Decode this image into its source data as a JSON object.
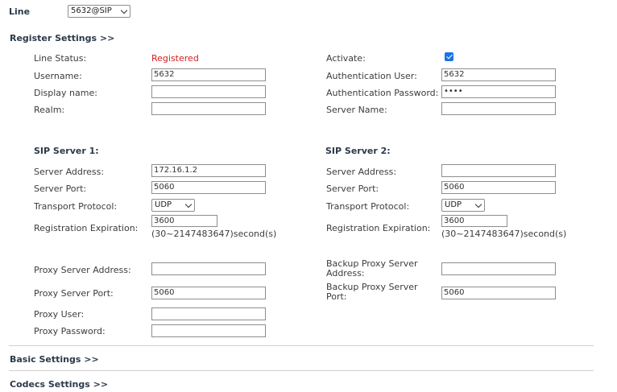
{
  "line": {
    "label": "Line",
    "selected": "5632@SIP"
  },
  "register_settings": {
    "header": "Register Settings >>",
    "left": {
      "line_status_label": "Line Status:",
      "line_status_value": "Registered",
      "username_label": "Username:",
      "username_value": "5632",
      "display_name_label": "Display name:",
      "display_name_value": "",
      "realm_label": "Realm:",
      "realm_value": ""
    },
    "right": {
      "activate_label": "Activate:",
      "activate_checked": true,
      "auth_user_label": "Authentication User:",
      "auth_user_value": "5632",
      "auth_password_label": "Authentication Password:",
      "auth_password_value": "••••",
      "server_name_label": "Server Name:",
      "server_name_value": ""
    }
  },
  "sip_server_1": {
    "title": "SIP Server 1:",
    "server_address_label": "Server Address:",
    "server_address_value": "172.16.1.2",
    "server_port_label": "Server Port:",
    "server_port_value": "5060",
    "transport_label": "Transport Protocol:",
    "transport_value": "UDP",
    "expiration_label": "Registration Expiration:",
    "expiration_value": "3600",
    "expiration_hint": "(30~2147483647)second(s)"
  },
  "sip_server_2": {
    "title": "SIP Server 2:",
    "server_address_label": "Server Address:",
    "server_address_value": "",
    "server_port_label": "Server Port:",
    "server_port_value": "5060",
    "transport_label": "Transport Protocol:",
    "transport_value": "UDP",
    "expiration_label": "Registration Expiration:",
    "expiration_value": "3600",
    "expiration_hint": "(30~2147483647)second(s)"
  },
  "proxy": {
    "proxy_address_label": "Proxy Server Address:",
    "proxy_address_value": "",
    "proxy_port_label": "Proxy Server Port:",
    "proxy_port_value": "5060",
    "proxy_user_label": "Proxy User:",
    "proxy_user_value": "",
    "proxy_password_label": "Proxy Password:",
    "proxy_password_value": "",
    "backup_address_label": "Backup Proxy Server Address:",
    "backup_address_value": "",
    "backup_port_label": "Backup Proxy Server Port:",
    "backup_port_value": "5060"
  },
  "basic_settings": {
    "header": "Basic Settings >>"
  },
  "codecs_settings": {
    "header": "Codecs Settings >>"
  },
  "colors": {
    "accent": "#1a73e8",
    "status_registered": "#d42020"
  }
}
